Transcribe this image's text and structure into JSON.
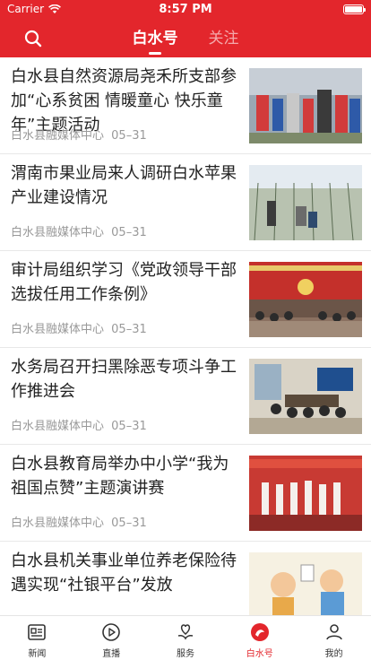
{
  "status_bar": {
    "carrier": "Carrier",
    "time": "8:57 PM"
  },
  "header": {
    "search_icon": "search-icon",
    "tabs": [
      {
        "label": "白水号",
        "active": true
      },
      {
        "label": "关注",
        "active": false
      }
    ]
  },
  "articles": [
    {
      "title": "白水县自然资源局尧禾所支部参加“心系贫困 情暖童心 快乐童年”主题活动",
      "source": "白水县融媒体中心",
      "date": "05–31"
    },
    {
      "title": "渭南市果业局来人调研白水苹果产业建设情况",
      "source": "白水县融媒体中心",
      "date": "05–31"
    },
    {
      "title": "审计局组织学习《党政领导干部选拔任用工作条例》",
      "source": "白水县融媒体中心",
      "date": "05–31"
    },
    {
      "title": "水务局召开扫黑除恶专项斗争工作推进会",
      "source": "白水县融媒体中心",
      "date": "05–31"
    },
    {
      "title": "白水县教育局举办中小学“我为祖国点赞”主题演讲赛",
      "source": "白水县融媒体中心",
      "date": "05–31"
    },
    {
      "title": "白水县机关事业单位养老保险待遇实现“社银平台”发放",
      "source": "",
      "date": ""
    }
  ],
  "tab_bar": {
    "items": [
      {
        "label": "新闻",
        "icon": "newspaper-icon",
        "active": false
      },
      {
        "label": "直播",
        "icon": "play-icon",
        "active": false
      },
      {
        "label": "服务",
        "icon": "heart-hand-icon",
        "active": false
      },
      {
        "label": "白水号",
        "icon": "baishui-logo-icon",
        "active": true
      },
      {
        "label": "我的",
        "icon": "person-icon",
        "active": false
      }
    ]
  },
  "colors": {
    "brand_red": "#e3262c",
    "meta_gray": "#999999"
  }
}
